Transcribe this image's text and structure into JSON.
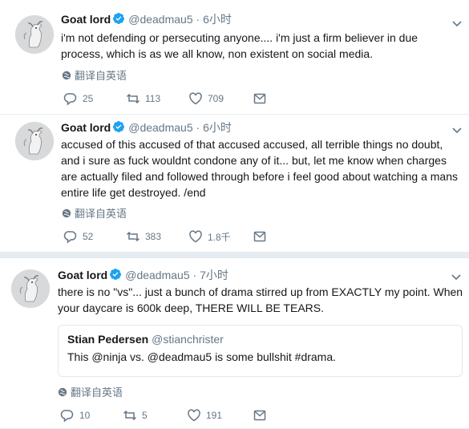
{
  "tweets": [
    {
      "name": "Goat lord",
      "handle": "@deadmau5",
      "dot": "·",
      "time": "6小时",
      "text": "i'm not defending or persecuting anyone.... i'm just a firm believer in due process, which is as we all know, non existent on social media.",
      "translate": "翻译自英语",
      "replies": "25",
      "retweets": "113",
      "likes": "709"
    },
    {
      "name": "Goat lord",
      "handle": "@deadmau5",
      "dot": "·",
      "time": "6小时",
      "text": "accused of this accused of that accused accused, all terrible things no doubt, and i sure as fuck wouldnt condone any of it... but, let me know when charges are actually filed and followed through before i feel good about watching a mans entire life get destroyed. /end",
      "translate": "翻译自英语",
      "replies": "52",
      "retweets": "383",
      "likes": "1.8千"
    },
    {
      "name": "Goat lord",
      "handle": "@deadmau5",
      "dot": "·",
      "time": "7小时",
      "text": "there is no \"vs\"... just a bunch of drama stirred up from EXACTLY my point. When your daycare is 600k deep, THERE WILL BE TEARS.",
      "quote": {
        "name": "Stian Pedersen",
        "handle": "@stianchrister",
        "text": "This @ninja vs. @deadmau5 is some bullshit #drama."
      },
      "translate": "翻译自英语",
      "replies": "10",
      "retweets": "5",
      "likes": "191"
    }
  ],
  "colors": {
    "verified": "#1da1f2",
    "muted": "#657786",
    "text": "#14171a",
    "border": "#e6ecf0"
  },
  "icons": [
    "verified-badge-icon",
    "chevron-down-icon",
    "globe-icon",
    "reply-icon",
    "retweet-icon",
    "like-icon",
    "message-icon"
  ]
}
